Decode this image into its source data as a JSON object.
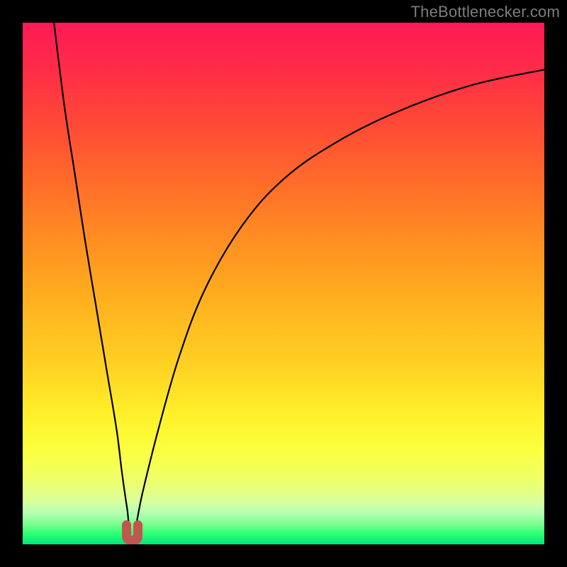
{
  "watermark": {
    "text": "TheBottlenecker.com"
  },
  "chart_data": {
    "type": "line",
    "title": "",
    "xlabel": "",
    "ylabel": "",
    "xlim": [
      0,
      100
    ],
    "ylim": [
      0,
      100
    ],
    "vertex_x_pct": 21,
    "series": [
      {
        "name": "left-branch",
        "x": [
          6,
          8,
          10,
          12,
          14,
          16,
          18,
          19,
          20,
          21
        ],
        "y": [
          100,
          84,
          71,
          58,
          46,
          34,
          22,
          14,
          7,
          1
        ]
      },
      {
        "name": "right-branch",
        "x": [
          21,
          23,
          26,
          30,
          35,
          42,
          50,
          60,
          72,
          86,
          100
        ],
        "y": [
          1,
          10,
          22,
          36,
          49,
          61,
          70,
          77,
          83,
          88,
          91
        ]
      },
      {
        "name": "vertex-marker",
        "marker": "u-shape",
        "color": "#c1564f",
        "x": [
          19.5,
          22.5
        ],
        "y": [
          2,
          2
        ]
      }
    ],
    "background_gradient": {
      "top": "#ff1a55",
      "mid": "#fff02a",
      "bottom": "#00e57a"
    },
    "grid": false,
    "legend": null
  }
}
